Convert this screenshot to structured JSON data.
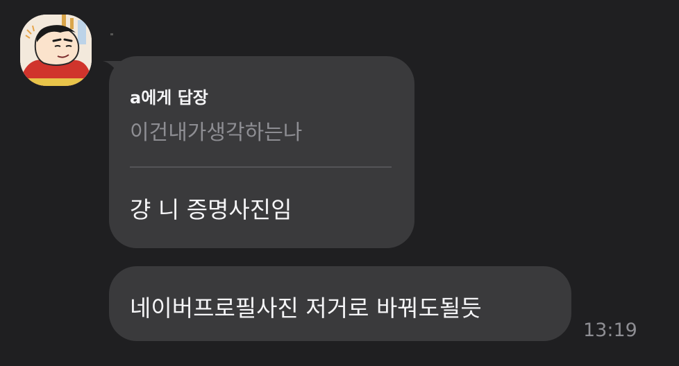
{
  "conversation": {
    "sender_avatar_icon": "cartoon-boy-avatar-icon",
    "messages": [
      {
        "reply_to": {
          "title": "a에게 답장",
          "quoted_text": "이건내가생각하는나"
        },
        "text": "걍 니 증명사진임"
      },
      {
        "text": "네이버프로필사진 저거로 바꿔도될듯",
        "timestamp": "13:19"
      }
    ]
  },
  "colors": {
    "background": "#1f1f21",
    "bubble": "#3a3a3c",
    "text_primary": "#f5f5f7",
    "text_secondary": "#8e8e93"
  }
}
